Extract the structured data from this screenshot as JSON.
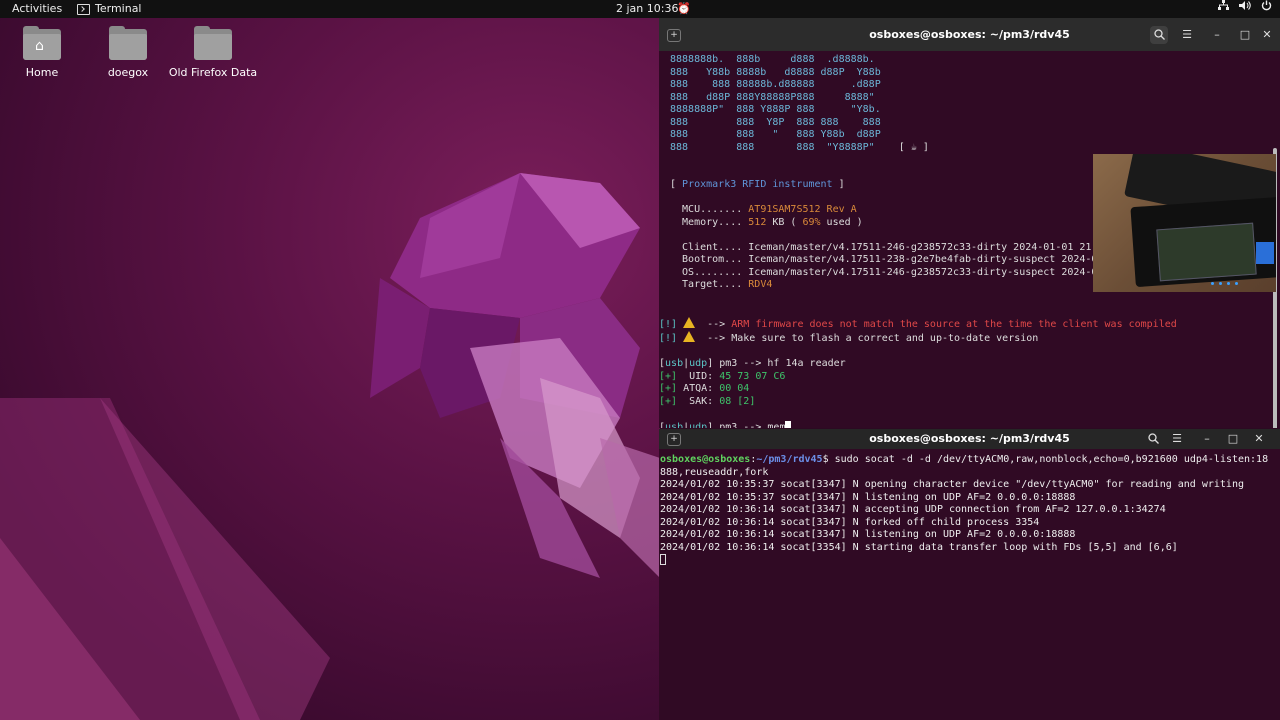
{
  "topbar": {
    "activities": "Activities",
    "app_name": "Terminal",
    "clock": "2 jan  10:36"
  },
  "desktop": {
    "icons": [
      {
        "label": "Home"
      },
      {
        "label": "doegox"
      },
      {
        "label": "Old Firefox Data"
      }
    ]
  },
  "term1": {
    "title": "osboxes@osboxes: ~/pm3/rdv45",
    "ascii": [
      "8888888b.  888b     d888  .d8888b.",
      "888   Y88b 8888b   d8888 d88P  Y88b",
      "888    888 88888b.d88888      .d88P",
      "888   d88P 888Y88888P888     8888\"",
      "8888888P\"  888 Y888P 888      \"Y8b.",
      "888        888  Y8P  888 888    888",
      "888        888   \"   888 Y88b  d88P",
      "888        888       888  \"Y8888P\""
    ],
    "coffee": "[ ☕ ]",
    "banner_l": "[ ",
    "banner": "Proxmark3 RFID instrument",
    "banner_r": " ]",
    "mcu_label": "  MCU....... ",
    "mcu_value": "AT91SAM7S512 Rev A",
    "mem_label": "  Memory.... ",
    "mem_value1": "512",
    "mem_mid": " KB ( ",
    "mem_value2": "69%",
    "mem_end": " used )",
    "client_line": "  Client.... Iceman/master/v4.17511-246-g238572c33-dirty 2024-01-01 21:",
    "bootrom_line": "  Bootrom... Iceman/master/v4.17511-238-g2e7be4fab-dirty-suspect 2024-0",
    "os_line": "  OS........ Iceman/master/v4.17511-246-g238572c33-dirty-suspect 2024-0",
    "target_label": "  Target.... ",
    "target_value": "RDV4",
    "warn_tag": "[!]",
    "arrow": " -->",
    "warn1": "ARM firmware does not match the source at the time the client was compiled",
    "warn2": "Make sure to flash a correct and up-to-date version",
    "prompt_l": "[",
    "prompt_usb": "usb",
    "prompt_bar": "|",
    "prompt_udp": "udp",
    "prompt_r": "] pm3 --> ",
    "cmd1": "hf 14a reader",
    "plus": "[+]",
    "uid_label": "  UID: ",
    "uid_value": "45 73 07 C6",
    "atqa_label": " ATQA: ",
    "atqa_value": "00 04",
    "sak_label": "  SAK: ",
    "sak_value": "08 [2]",
    "cmd2": "mem"
  },
  "term2": {
    "title": "osboxes@osboxes: ~/pm3/rdv45",
    "user_host": "osboxes@osboxes",
    "colon": ":",
    "cwd": "~/pm3/rdv45",
    "dollar": "$ ",
    "cmd": "sudo socat -d -d /dev/ttyACM0,raw,nonblock,echo=0,b921600 udp4-listen:18",
    "cmd_wrap": "888,reuseaddr,fork",
    "log": [
      "2024/01/02 10:35:37 socat[3347] N opening character device \"/dev/ttyACM0\" for reading and writing",
      "2024/01/02 10:35:37 socat[3347] N listening on UDP AF=2 0.0.0.0:18888",
      "2024/01/02 10:36:14 socat[3347] N accepting UDP connection from AF=2 127.0.0.1:34274",
      "2024/01/02 10:36:14 socat[3347] N forked off child process 3354",
      "2024/01/02 10:36:14 socat[3347] N listening on UDP AF=2 0.0.0.0:18888",
      "2024/01/02 10:36:14 socat[3354] N starting data transfer loop with FDs [5,5] and [6,6]"
    ]
  },
  "colors": {
    "terminal_bg": "#300a24",
    "accent": "#e85a8a",
    "ascii": "#6cb7d8",
    "warning": "#e04848",
    "value": "#3ec46a"
  }
}
